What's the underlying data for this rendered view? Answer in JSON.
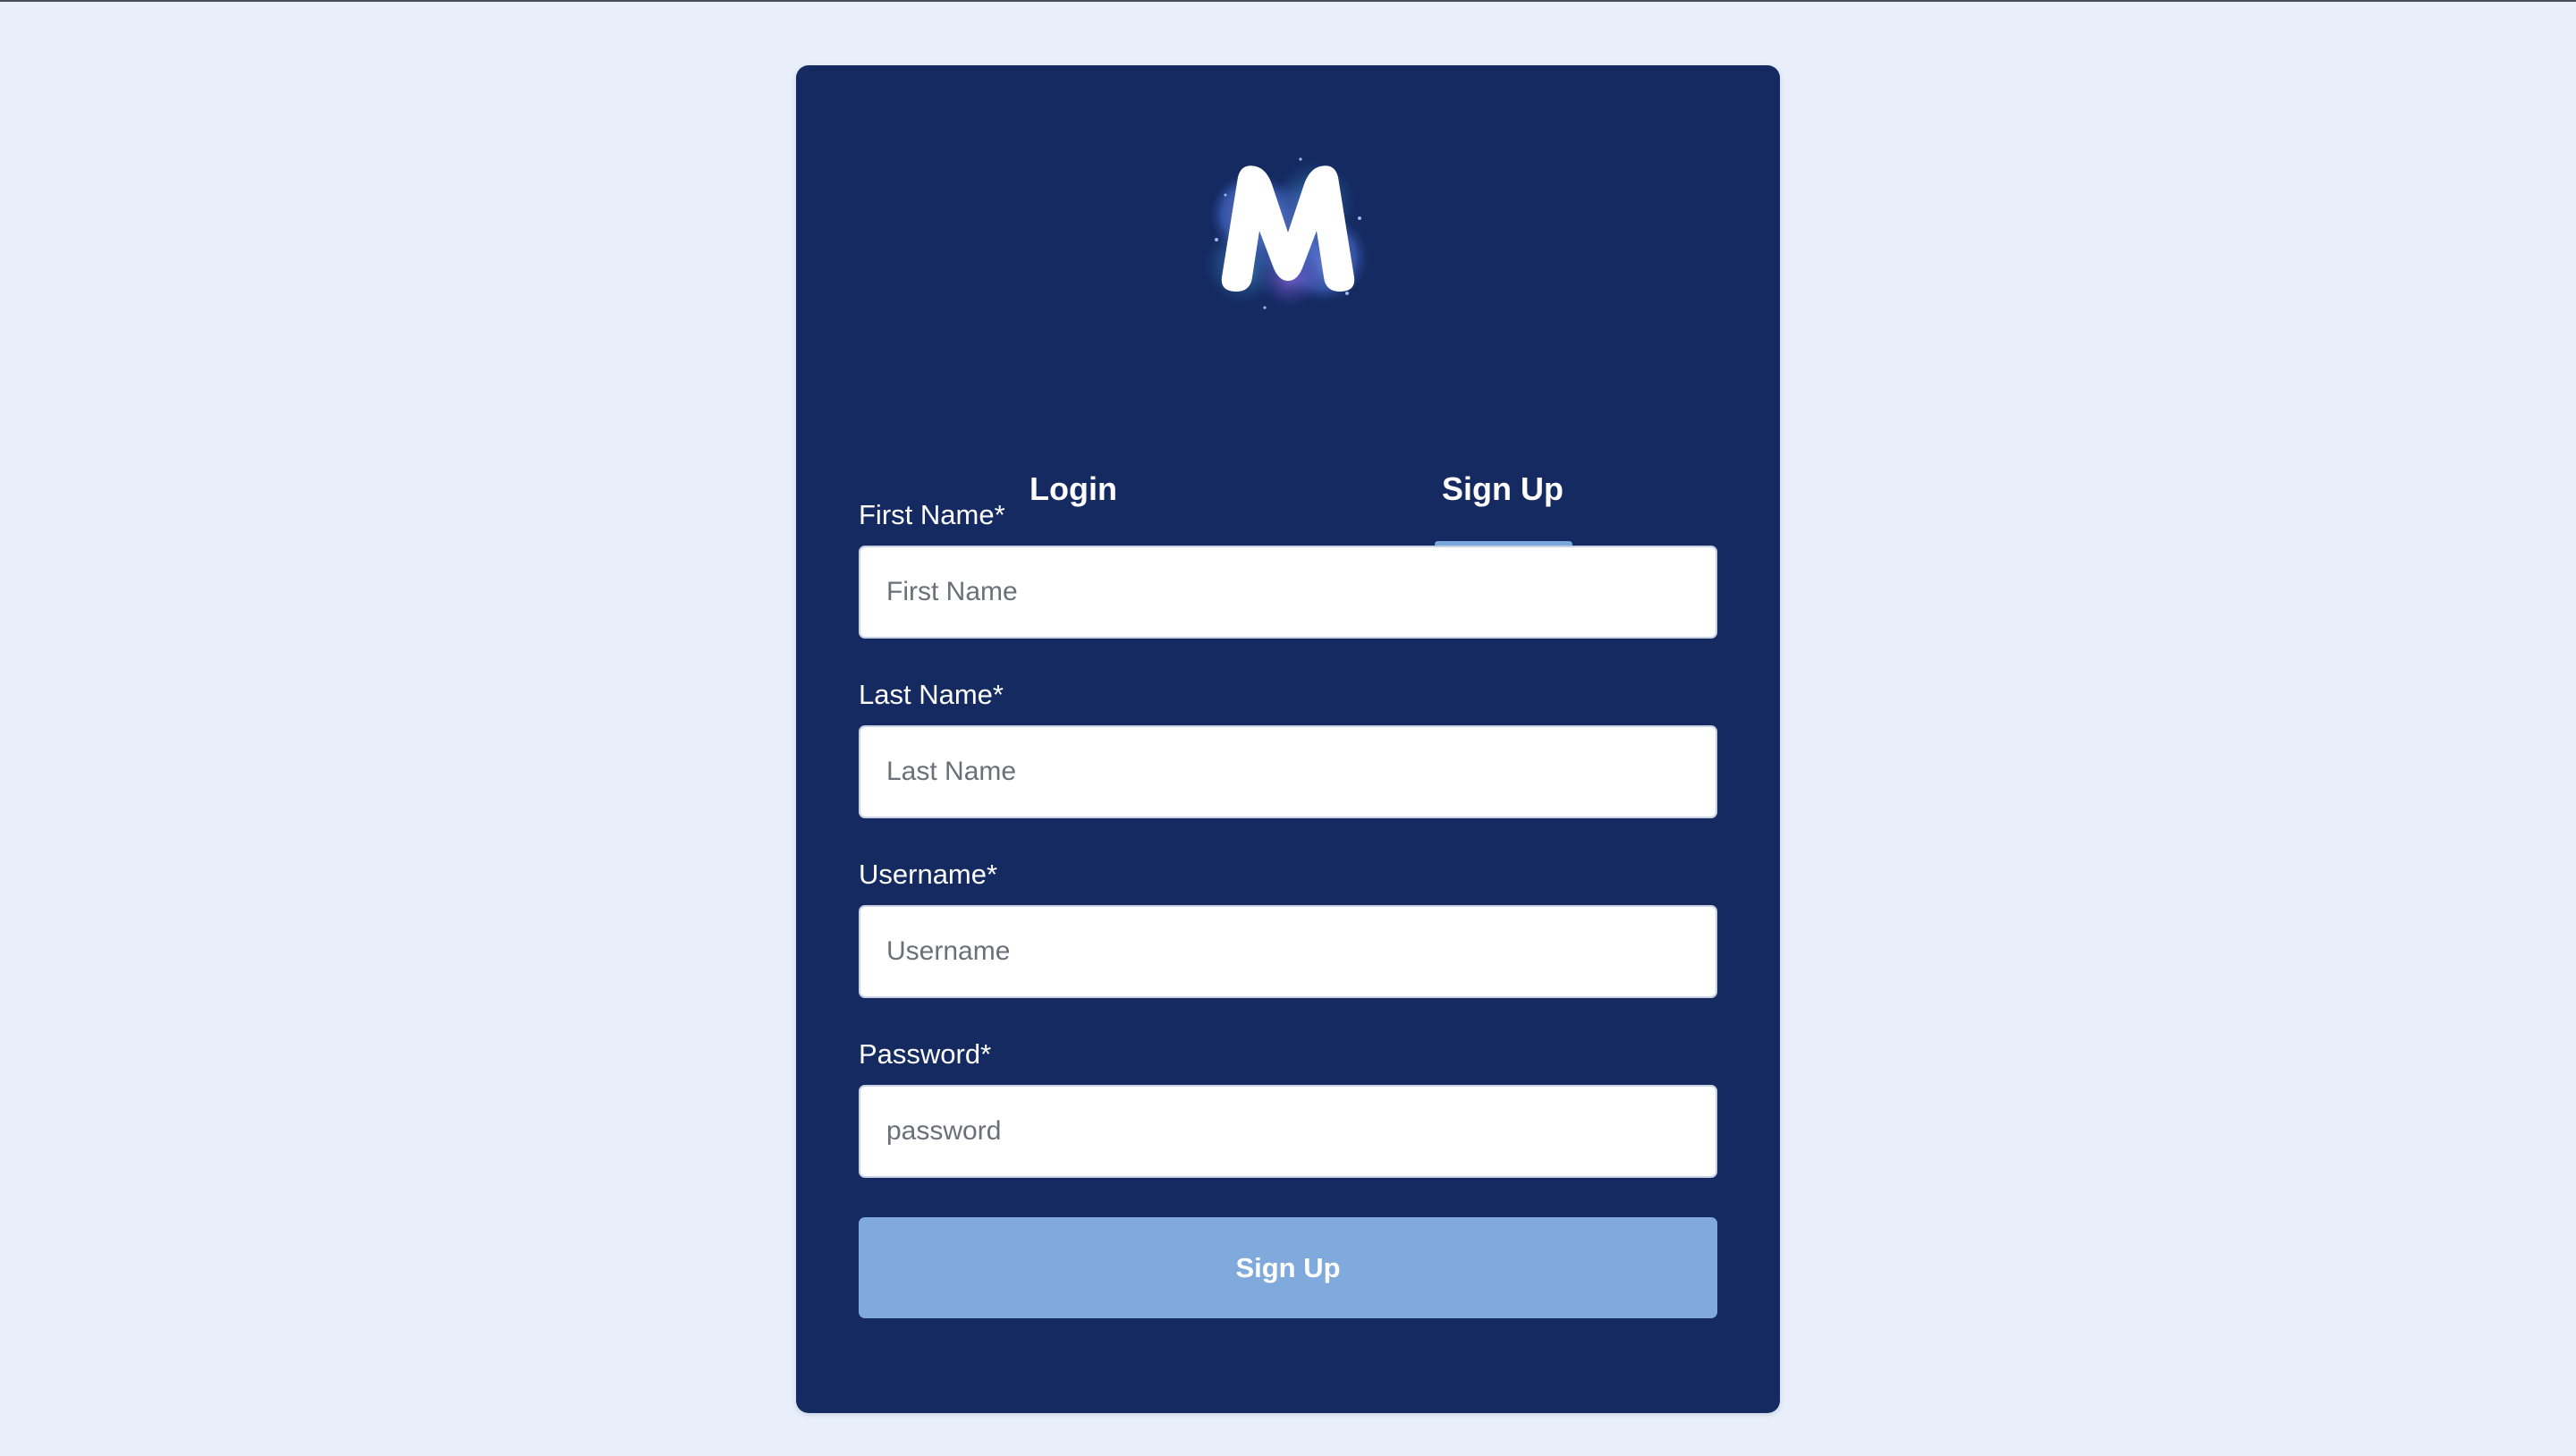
{
  "logo": {
    "icon": "m-logo-icon",
    "letter": "M"
  },
  "tabs": [
    {
      "label": "Login",
      "active": false
    },
    {
      "label": "Sign Up",
      "active": true
    }
  ],
  "form": {
    "fields": [
      {
        "label": "First Name*",
        "placeholder": "First Name",
        "value": ""
      },
      {
        "label": "Last Name*",
        "placeholder": "Last Name",
        "value": ""
      },
      {
        "label": "Username*",
        "placeholder": "Username",
        "value": ""
      },
      {
        "label": "Password*",
        "placeholder": "password",
        "value": ""
      }
    ],
    "submit_label": "Sign Up"
  },
  "colors": {
    "page_background": "#e8effa",
    "card_background": "#142a61",
    "accent": "#80a9dc",
    "tab_indicator": "#7aa7dc"
  }
}
